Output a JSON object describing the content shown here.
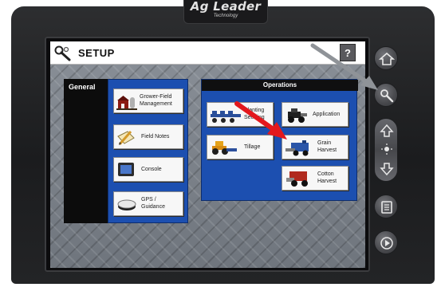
{
  "device": {
    "brand": "Ag Leader",
    "brand_sub": "Technology"
  },
  "title_bar": {
    "title": "SETUP",
    "help_label": "?"
  },
  "general": {
    "label": "General",
    "items": [
      {
        "label_line1": "Grower-Field",
        "label_line2": "Management",
        "icon": "barn-icon"
      },
      {
        "label_line1": "Field Notes",
        "label_line2": "",
        "icon": "pencil-notepad-icon"
      },
      {
        "label_line1": "Console",
        "label_line2": "",
        "icon": "console-display-icon"
      },
      {
        "label_line1": "GPS /",
        "label_line2": "Guidance",
        "icon": "gps-receiver-icon"
      }
    ]
  },
  "operations": {
    "label": "Operations",
    "items": [
      {
        "label_line1": "Planting",
        "label_line2": "Seeding",
        "icon": "planter-icon"
      },
      {
        "label_line1": "Application",
        "label_line2": "",
        "icon": "sprayer-tractor-icon"
      },
      {
        "label_line1": "Tillage",
        "label_line2": "",
        "icon": "tillage-tractor-icon"
      },
      {
        "label_line1": "Grain",
        "label_line2": "Harvest",
        "icon": "combine-icon"
      },
      {
        "label_line1": "Cotton",
        "label_line2": "Harvest",
        "icon": "cotton-picker-icon"
      }
    ]
  },
  "side_buttons": [
    "home-icon",
    "wrench-icon",
    "brightness-up-icon",
    "brightness-down-icon",
    "manual-icon",
    "run-screen-icon"
  ],
  "annotations": {
    "gray_arrow_color": "#8f9398",
    "red_arrow_color": "#e3181d"
  },
  "colors": {
    "panel_blue": "#1c4fb0",
    "panel_black": "#0c0c0c",
    "title_bar": "#ffffff"
  }
}
